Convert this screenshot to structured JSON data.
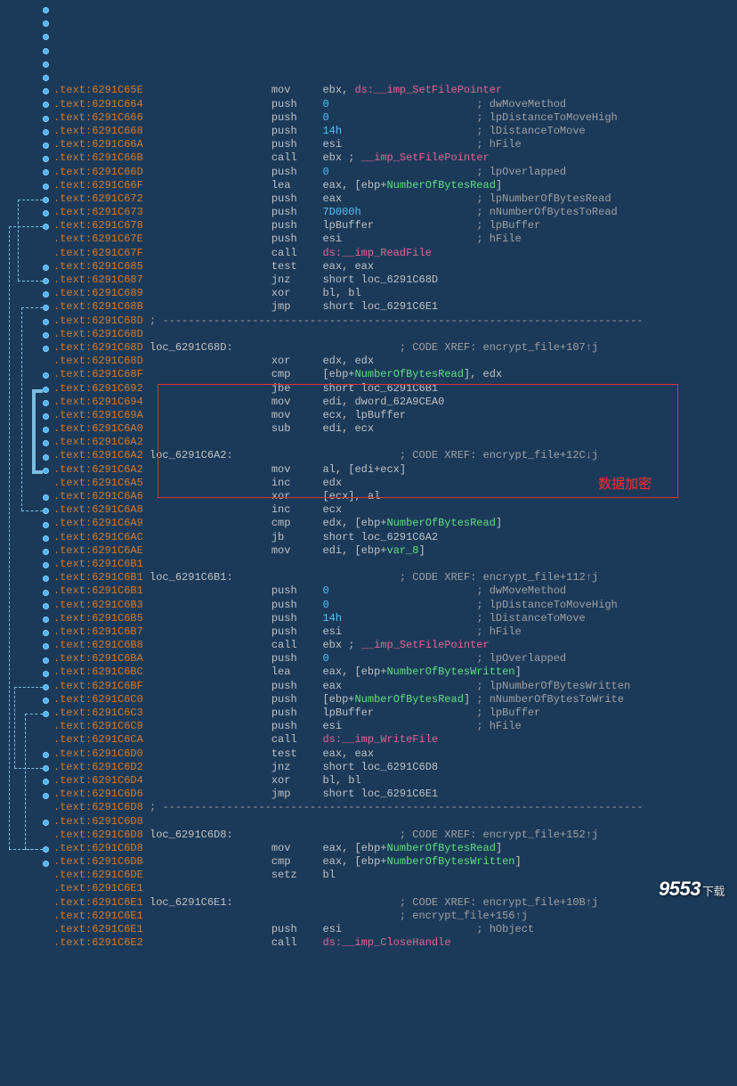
{
  "annotation_label": "数据加密",
  "watermark": {
    "main": "9553",
    "sub": "下载"
  },
  "lines": [
    {
      "a": ".text:6291C65E",
      "op": "mov",
      "args": [
        [
          "plain",
          "ebx, "
        ],
        [
          "imp",
          "ds:__imp_SetFilePointer"
        ]
      ]
    },
    {
      "a": ".text:6291C664",
      "op": "push",
      "args": [
        [
          "num",
          "0"
        ]
      ],
      "c": "; dwMoveMethod"
    },
    {
      "a": ".text:6291C666",
      "op": "push",
      "args": [
        [
          "num",
          "0"
        ]
      ],
      "c": "; lpDistanceToMoveHigh"
    },
    {
      "a": ".text:6291C668",
      "op": "push",
      "args": [
        [
          "num",
          "14h"
        ]
      ],
      "c": "; lDistanceToMove"
    },
    {
      "a": ".text:6291C66A",
      "op": "push",
      "args": [
        [
          "plain",
          "esi"
        ]
      ],
      "c": "; hFile"
    },
    {
      "a": ".text:6291C66B",
      "op": "call",
      "args": [
        [
          "plain",
          "ebx ; "
        ],
        [
          "imp",
          "__imp_SetFilePointer"
        ]
      ]
    },
    {
      "a": ".text:6291C66D",
      "op": "push",
      "args": [
        [
          "num",
          "0"
        ]
      ],
      "c": "; lpOverlapped"
    },
    {
      "a": ".text:6291C66F",
      "op": "lea",
      "args": [
        [
          "plain",
          "eax, [ebp+"
        ],
        [
          "sym",
          "NumberOfBytesRead"
        ],
        [
          "plain",
          "]"
        ]
      ]
    },
    {
      "a": ".text:6291C672",
      "op": "push",
      "args": [
        [
          "plain",
          "eax"
        ]
      ],
      "c": "; lpNumberOfBytesRead"
    },
    {
      "a": ".text:6291C673",
      "op": "push",
      "args": [
        [
          "num",
          "7D000h"
        ]
      ],
      "c": "; nNumberOfBytesToRead"
    },
    {
      "a": ".text:6291C678",
      "op": "push",
      "args": [
        [
          "plain",
          "lpBuffer"
        ]
      ],
      "c": "; lpBuffer"
    },
    {
      "a": ".text:6291C67E",
      "op": "push",
      "args": [
        [
          "plain",
          "esi"
        ]
      ],
      "c": "; hFile"
    },
    {
      "a": ".text:6291C67F",
      "op": "call",
      "args": [
        [
          "imp",
          "ds:__imp_ReadFile"
        ]
      ]
    },
    {
      "a": ".text:6291C685",
      "op": "test",
      "args": [
        [
          "plain",
          "eax, eax"
        ]
      ]
    },
    {
      "a": ".text:6291C687",
      "op": "jnz",
      "args": [
        [
          "plain",
          "short loc_6291C68D"
        ]
      ]
    },
    {
      "a": ".text:6291C689",
      "op": "xor",
      "args": [
        [
          "plain",
          "bl, bl"
        ]
      ]
    },
    {
      "a": ".text:6291C68B",
      "op": "jmp",
      "args": [
        [
          "plain",
          "short loc_6291C6E1"
        ]
      ]
    },
    {
      "a": ".text:6291C68D",
      "sep": "; ---------------------------------------------------------------------------"
    },
    {
      "a": ".text:6291C68D",
      "blank": true
    },
    {
      "a": ".text:6291C68D",
      "label": "loc_6291C68D:",
      "c": "; CODE XREF: encrypt_file+107↑j"
    },
    {
      "a": ".text:6291C68D",
      "op": "xor",
      "args": [
        [
          "plain",
          "edx, edx"
        ]
      ]
    },
    {
      "a": ".text:6291C68F",
      "op": "cmp",
      "args": [
        [
          "plain",
          "[ebp+"
        ],
        [
          "sym",
          "NumberOfBytesRead"
        ],
        [
          "plain",
          "], edx"
        ]
      ]
    },
    {
      "a": ".text:6291C692",
      "op": "jbe",
      "args": [
        [
          "plain",
          "short loc_6291C6B1"
        ]
      ]
    },
    {
      "a": ".text:6291C694",
      "op": "mov",
      "args": [
        [
          "plain",
          "edi, dword_62A9CEA0"
        ]
      ]
    },
    {
      "a": ".text:6291C69A",
      "op": "mov",
      "args": [
        [
          "plain",
          "ecx, lpBuffer"
        ]
      ]
    },
    {
      "a": ".text:6291C6A0",
      "op": "sub",
      "args": [
        [
          "plain",
          "edi, ecx"
        ]
      ]
    },
    {
      "a": ".text:6291C6A2",
      "blank": true
    },
    {
      "a": ".text:6291C6A2",
      "label": "loc_6291C6A2:",
      "c": "; CODE XREF: encrypt_file+12C↓j"
    },
    {
      "a": ".text:6291C6A2",
      "op": "mov",
      "args": [
        [
          "plain",
          "al, [edi+ecx]"
        ]
      ]
    },
    {
      "a": ".text:6291C6A5",
      "op": "inc",
      "args": [
        [
          "plain",
          "edx"
        ]
      ]
    },
    {
      "a": ".text:6291C6A6",
      "op": "xor",
      "args": [
        [
          "plain",
          "[ecx], al"
        ]
      ]
    },
    {
      "a": ".text:6291C6A8",
      "op": "inc",
      "args": [
        [
          "plain",
          "ecx"
        ]
      ]
    },
    {
      "a": ".text:6291C6A9",
      "op": "cmp",
      "args": [
        [
          "plain",
          "edx, [ebp+"
        ],
        [
          "sym",
          "NumberOfBytesRead"
        ],
        [
          "plain",
          "]"
        ]
      ]
    },
    {
      "a": ".text:6291C6AC",
      "op": "jb",
      "args": [
        [
          "plain",
          "short loc_6291C6A2"
        ]
      ]
    },
    {
      "a": ".text:6291C6AE",
      "op": "mov",
      "args": [
        [
          "plain",
          "edi, [ebp+"
        ],
        [
          "sym",
          "var_8"
        ],
        [
          "plain",
          "]"
        ]
      ]
    },
    {
      "a": ".text:6291C6B1",
      "blank": true
    },
    {
      "a": ".text:6291C6B1",
      "label": "loc_6291C6B1:",
      "c": "; CODE XREF: encrypt_file+112↑j"
    },
    {
      "a": ".text:6291C6B1",
      "op": "push",
      "args": [
        [
          "num",
          "0"
        ]
      ],
      "c": "; dwMoveMethod"
    },
    {
      "a": ".text:6291C6B3",
      "op": "push",
      "args": [
        [
          "num",
          "0"
        ]
      ],
      "c": "; lpDistanceToMoveHigh"
    },
    {
      "a": ".text:6291C6B5",
      "op": "push",
      "args": [
        [
          "num",
          "14h"
        ]
      ],
      "c": "; lDistanceToMove"
    },
    {
      "a": ".text:6291C6B7",
      "op": "push",
      "args": [
        [
          "plain",
          "esi"
        ]
      ],
      "c": "; hFile"
    },
    {
      "a": ".text:6291C6B8",
      "op": "call",
      "args": [
        [
          "plain",
          "ebx ; "
        ],
        [
          "imp",
          "__imp_SetFilePointer"
        ]
      ]
    },
    {
      "a": ".text:6291C6BA",
      "op": "push",
      "args": [
        [
          "num",
          "0"
        ]
      ],
      "c": "; lpOverlapped"
    },
    {
      "a": ".text:6291C6BC",
      "op": "lea",
      "args": [
        [
          "plain",
          "eax, [ebp+"
        ],
        [
          "sym",
          "NumberOfBytesWritten"
        ],
        [
          "plain",
          "]"
        ]
      ]
    },
    {
      "a": ".text:6291C6BF",
      "op": "push",
      "args": [
        [
          "plain",
          "eax"
        ]
      ],
      "c": "; lpNumberOfBytesWritten"
    },
    {
      "a": ".text:6291C6C0",
      "op": "push",
      "args": [
        [
          "plain",
          "[ebp+"
        ],
        [
          "sym",
          "NumberOfBytesRead"
        ],
        [
          "plain",
          "]"
        ]
      ],
      "c": "; nNumberOfBytesToWrite"
    },
    {
      "a": ".text:6291C6C3",
      "op": "push",
      "args": [
        [
          "plain",
          "lpBuffer"
        ]
      ],
      "c": "; lpBuffer"
    },
    {
      "a": ".text:6291C6C9",
      "op": "push",
      "args": [
        [
          "plain",
          "esi"
        ]
      ],
      "c": "; hFile"
    },
    {
      "a": ".text:6291C6CA",
      "op": "call",
      "args": [
        [
          "imp",
          "ds:__imp_WriteFile"
        ]
      ]
    },
    {
      "a": ".text:6291C6D0",
      "op": "test",
      "args": [
        [
          "plain",
          "eax, eax"
        ]
      ]
    },
    {
      "a": ".text:6291C6D2",
      "op": "jnz",
      "args": [
        [
          "plain",
          "short loc_6291C6D8"
        ]
      ]
    },
    {
      "a": ".text:6291C6D4",
      "op": "xor",
      "args": [
        [
          "plain",
          "bl, bl"
        ]
      ]
    },
    {
      "a": ".text:6291C6D6",
      "op": "jmp",
      "args": [
        [
          "plain",
          "short loc_6291C6E1"
        ]
      ]
    },
    {
      "a": ".text:6291C6D8",
      "sep": "; ---------------------------------------------------------------------------"
    },
    {
      "a": ".text:6291C6D8",
      "blank": true
    },
    {
      "a": ".text:6291C6D8",
      "label": "loc_6291C6D8:",
      "c": "; CODE XREF: encrypt_file+152↑j"
    },
    {
      "a": ".text:6291C6D8",
      "op": "mov",
      "args": [
        [
          "plain",
          "eax, [ebp+"
        ],
        [
          "sym",
          "NumberOfBytesRead"
        ],
        [
          "plain",
          "]"
        ]
      ]
    },
    {
      "a": ".text:6291C6DB",
      "op": "cmp",
      "args": [
        [
          "plain",
          "eax, [ebp+"
        ],
        [
          "sym",
          "NumberOfBytesWritten"
        ],
        [
          "plain",
          "]"
        ]
      ]
    },
    {
      "a": ".text:6291C6DE",
      "op": "setz",
      "args": [
        [
          "plain",
          "bl"
        ]
      ]
    },
    {
      "a": ".text:6291C6E1",
      "blank": true
    },
    {
      "a": ".text:6291C6E1",
      "label": "loc_6291C6E1:",
      "c": "; CODE XREF: encrypt_file+10B↑j"
    },
    {
      "a": ".text:6291C6E1",
      "c2": "; encrypt_file+156↑j"
    },
    {
      "a": ".text:6291C6E1",
      "op": "push",
      "args": [
        [
          "plain",
          "esi"
        ]
      ],
      "c": "; hObject"
    },
    {
      "a": ".text:6291C6E2",
      "op": "call",
      "args": [
        [
          "imp",
          "ds:__imp_CloseHandle"
        ]
      ]
    }
  ]
}
